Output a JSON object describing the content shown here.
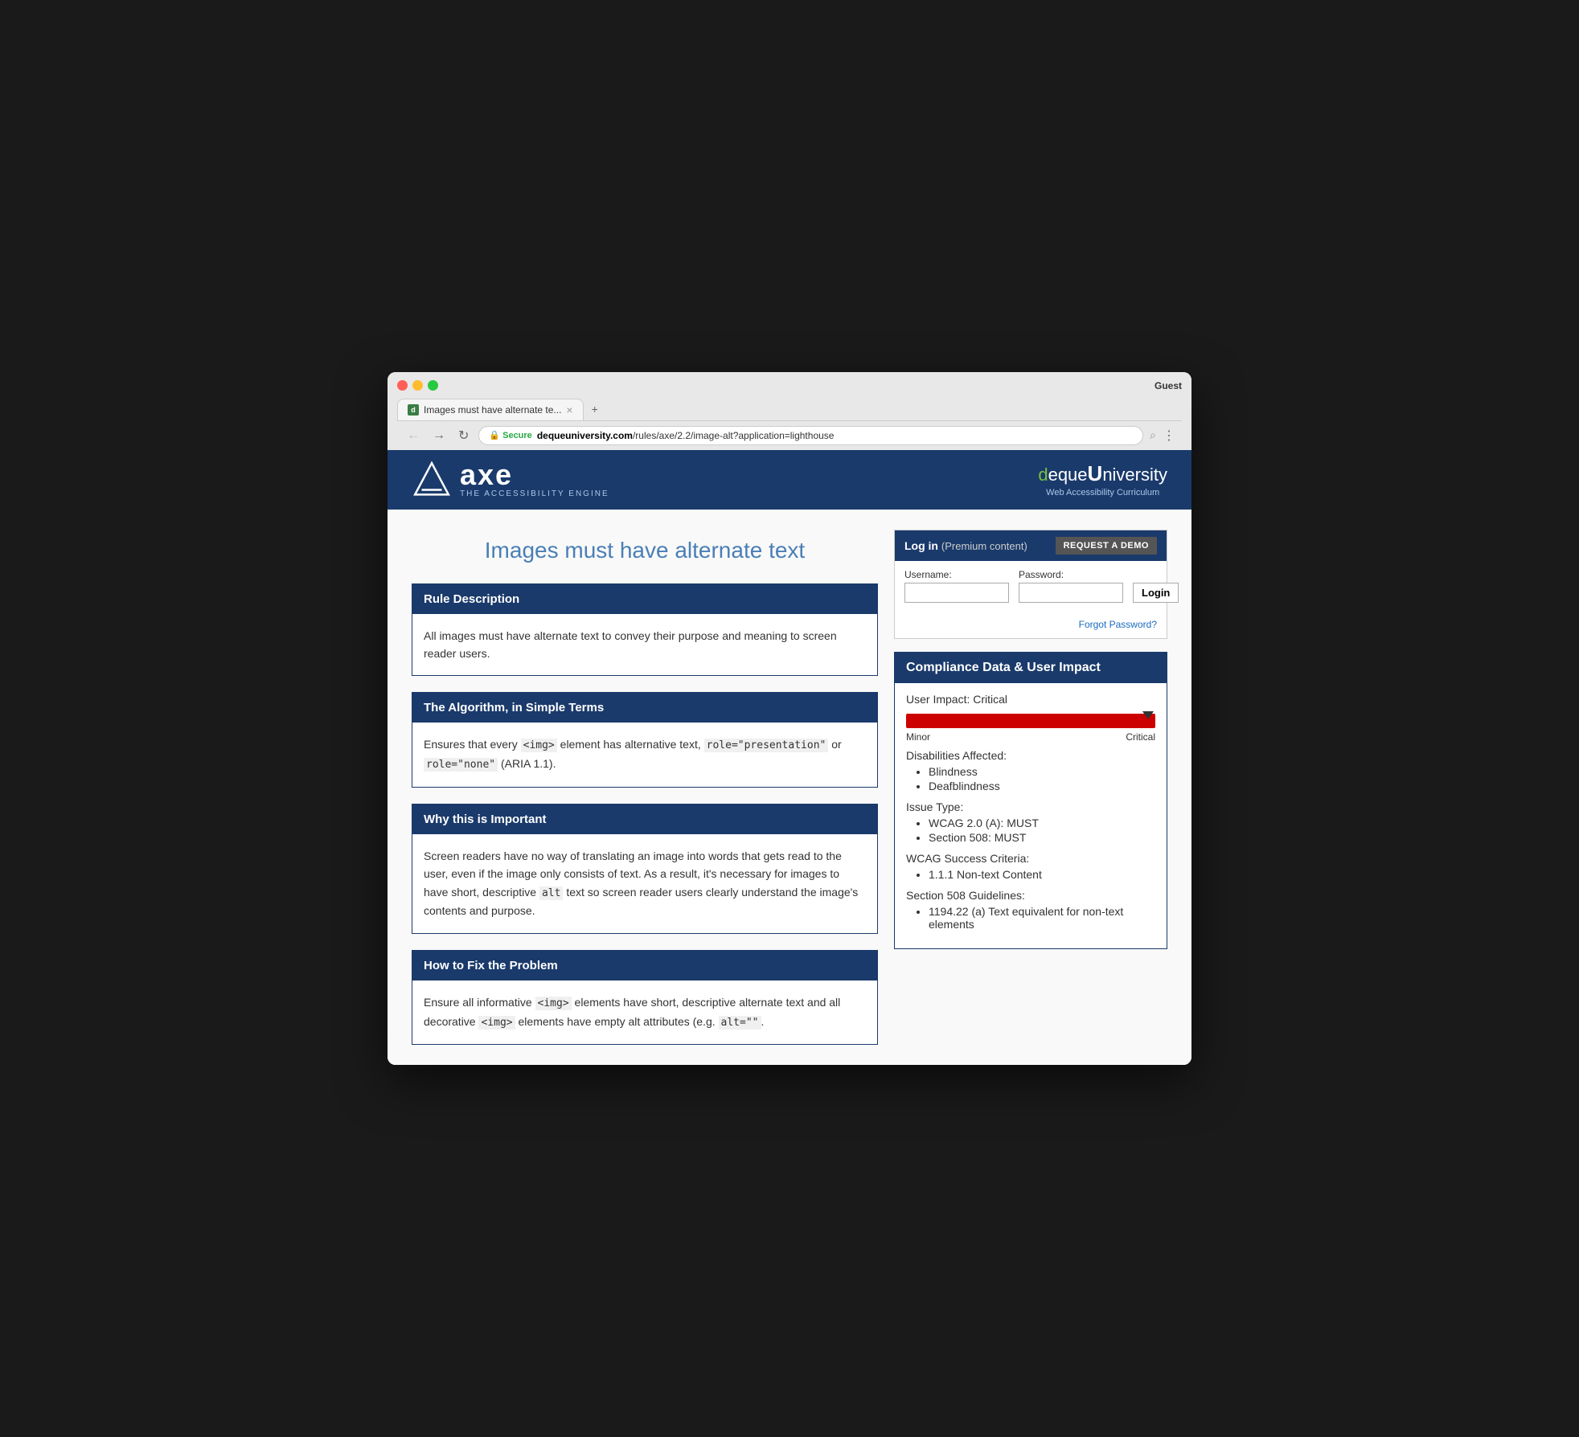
{
  "browser": {
    "tab_title": "Images must have alternate te...",
    "url_secure": "Secure",
    "url_full": "https://dequeuniversity.com/rules/axe/2.2/image-alt?application=lighthouse",
    "url_domain": "dequeuniversity.com",
    "url_path": "/rules/axe/2.2/image-alt?application=lighthouse",
    "guest_label": "Guest"
  },
  "header": {
    "tagline": "THE ACCESSIBILITY ENGINE",
    "deque_brand": "dequeUniversity",
    "deque_subtitle": "Web Accessibility Curriculum"
  },
  "page_title": "Images must have alternate text",
  "login_box": {
    "title": "Log in",
    "premium_text": "(Premium content)",
    "request_demo_btn": "REQUEST A DEMO",
    "username_label": "Username:",
    "password_label": "Password:",
    "login_btn": "Login",
    "forgot_password": "Forgot Password?"
  },
  "compliance": {
    "title": "Compliance Data & User Impact",
    "user_impact_label": "User Impact: Critical",
    "slider_min": "Minor",
    "slider_max": "Critical",
    "disabilities_title": "Disabilities Affected:",
    "disabilities": [
      "Blindness",
      "Deafblindness"
    ],
    "issue_type_title": "Issue Type:",
    "issue_types": [
      "WCAG 2.0 (A): MUST",
      "Section 508: MUST"
    ],
    "wcag_title": "WCAG Success Criteria:",
    "wcag_items": [
      "1.1.1 Non-text Content"
    ],
    "section508_title": "Section 508 Guidelines:",
    "section508_items": [
      "1194.22 (a) Text equivalent for non-text elements"
    ]
  },
  "rule_description": {
    "title": "Rule Description",
    "body": "All images must have alternate text to convey their purpose and meaning to screen reader users."
  },
  "algorithm": {
    "title": "The Algorithm, in Simple Terms",
    "body_plain": "Ensures that every ",
    "code1": "<img>",
    "body_mid": " element has alternative text, ",
    "code2": "role=\"presentation\"",
    "body_mid2": " or ",
    "code3": "role=\"none\"",
    "body_end": " (ARIA 1.1)."
  },
  "why_important": {
    "title": "Why this is Important",
    "body1": "Screen readers have no way of translating an image into words that gets read to the user, even if the image only consists of text. As a result, it's necessary for images to have short, descriptive ",
    "code1": "alt",
    "body2": " text so screen reader users clearly understand the image's contents and purpose."
  },
  "how_to_fix": {
    "title": "How to Fix the Problem",
    "body1": "Ensure all informative ",
    "code1": "<img>",
    "body2": " elements have short, descriptive alternate text and all decorative ",
    "code2": "<img>",
    "body3": " elements have empty alt attributes (e.g. ",
    "code3": "alt=\"\"",
    "body4": "."
  }
}
